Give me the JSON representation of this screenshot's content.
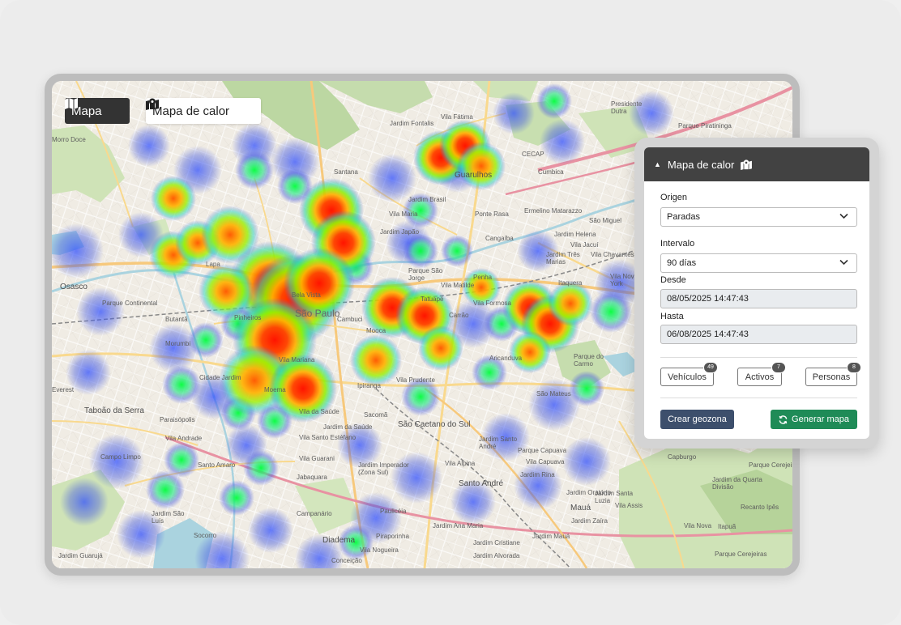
{
  "colors": {
    "outer_background": "#ececec",
    "panel_header": "#424242",
    "create_geozone": "#3d4f6c",
    "generate_map": "#1f8b57",
    "heat_low": "#4a5fe0",
    "heat_mid": "#22dd44",
    "heat_high": "#ff2200"
  },
  "view_toggle": {
    "map": {
      "label": "Mapa",
      "icon": "map-icon"
    },
    "heatmap": {
      "label": "Mapa de calor",
      "icon": "map-marker-icon"
    }
  },
  "panel": {
    "title": "Mapa de calor",
    "origin": {
      "label": "Origen",
      "value": "Paradas"
    },
    "interval": {
      "label": "Intervalo",
      "value": "90 días"
    },
    "from": {
      "label": "Desde",
      "value": "08/05/2025 14:47:43"
    },
    "to": {
      "label": "Hasta",
      "value": "06/08/2025 14:47:43"
    },
    "counts": [
      {
        "label": "Vehículos",
        "count": "49"
      },
      {
        "label": "Activos",
        "count": "7"
      },
      {
        "label": "Personas",
        "count": "8"
      }
    ],
    "create_geozone": "Crear geozona",
    "generate_map": "Generar mapa"
  },
  "map_labels": {
    "osasco": "Osasco",
    "sao_paulo": "São Paulo",
    "santo_andre": "Santo André",
    "maua": "Mauá",
    "diadema": "Diadema",
    "taboao": "Taboão\nda Serra",
    "guarulhos": "Guarulhos",
    "sao_caetano": "São Caetano\ndo Sul",
    "jardim_fontalis": "Jardim Fontalis",
    "morro_doce": "Morro Doce",
    "parque_continental": "Parque Continental",
    "capao_redondo": "Campo Limpo",
    "jabaquara": "Jabaquara",
    "ipiranga": "Ipiranga",
    "mooca": "Mooca",
    "lapa": "Lapa",
    "morumbi": "Morumbi",
    "moema": "Moema",
    "penha": "Penha",
    "santana": "Santana",
    "aricanduva": "Aricanduva",
    "vila_mariana": "Vila Mariana",
    "cambuci": "Cambuci",
    "santo_amaro": "Santo Amaro",
    "socorro": "Socorro",
    "cidade_jardim": "Cidade Jardim",
    "parque_do_carmo": "Parque do\nCarmo",
    "cumbica": "Cumbica",
    "sao_miguel": "São Miguel",
    "itaquera": "Itaquera",
    "sao_mateus": "São Mateus",
    "vila_prudente": "Vila Prudente",
    "sacoma": "Sacomã",
    "jardim_guaruja": "Jardim Guarujá",
    "sao_luis": "Jardim São\nLuís",
    "paraisopolis": "Paraisópolis",
    "vila_andrade": "Vila Andrade",
    "everest": "Everest",
    "butanta": "Butantã",
    "pinheiros": "Pinheiros",
    "bela_vista": "Bela Vista",
    "tatuape": "Tatuapé",
    "vila_matilde": "Vila Matilde",
    "jardim_helena": "Jardim Helena",
    "ermelino": "Ermelino Matarazzo",
    "ponte_rasa": "Ponte Rasa",
    "parque_pinheirinho": "Parque Piratininga",
    "presidente_dutra": "Presidente\nDutra",
    "cecap": "CECAP",
    "vila_fatima": "Vila Fátima",
    "jardim_brasil": "Jardim Brasil",
    "vila_maria": "Vila Maria",
    "jardim_japao": "Jardim Japão",
    "parque_sao_jorge": "Parque São\nJorge",
    "carrao": "Carrão",
    "vila_formosa": "Vila Formosa",
    "jardim_tres_marias": "Jardim Três\nMarias",
    "vila_chavantes": "Vila Chavantes",
    "vila_nova_york": "Vila Nova\nYork",
    "jardim_santo_andre": "Jardim Santo\nAndré",
    "capuava": "Vila Capuava",
    "jardim_rina": "Jardim Rina",
    "parque_capuava": "Parque Capuava",
    "jardim_oratorio": "Jardim Oratório",
    "santa_luzia": "Jardim Santa\nLuzia",
    "vila_assis": "Vila Assis",
    "jardim_zaira": "Jardim Zaíra",
    "jardim_mauá": "Jardim Mauá",
    "jardim_cristiane": "Jardim Cristiane",
    "campanario": "Campanário",
    "jardim_alvorada": "Jardim Alvorada",
    "conceicao": "Conceição",
    "piraporinha": "Piraporinha",
    "vila_nogueira": "Vila Nogueira",
    "paulicea": "Paulicéia",
    "jardim_imperador": "Jardim Imperador\n(Zona Sul)",
    "vila_guarani": "Vila Guarani",
    "vila_santo_estefano": "Vila Santo Estéfano",
    "jardim_da_saude": "Jardim da Saúde",
    "vila_da_saude": "Vila da Saúde",
    "cangaiba": "Cangaíba",
    "vila_jacui": "Vila Jacuí",
    "parque_cerejeira": "Parque Cerejeira",
    "capburgo": "Capburgo",
    "jardim_da_quarta": "Jardim da Quarta\nDivisão",
    "recanto_dos_ipes": "Recanto Ipês",
    "vila_nova": "Vila Nova",
    "parque_cerejeiras": "Parque Cerejeiras",
    "itapua": "Itapuã",
    "vila_alpina": "Vila Alpina",
    "jardim_ana_maria": "Jardim Ana Maria"
  }
}
